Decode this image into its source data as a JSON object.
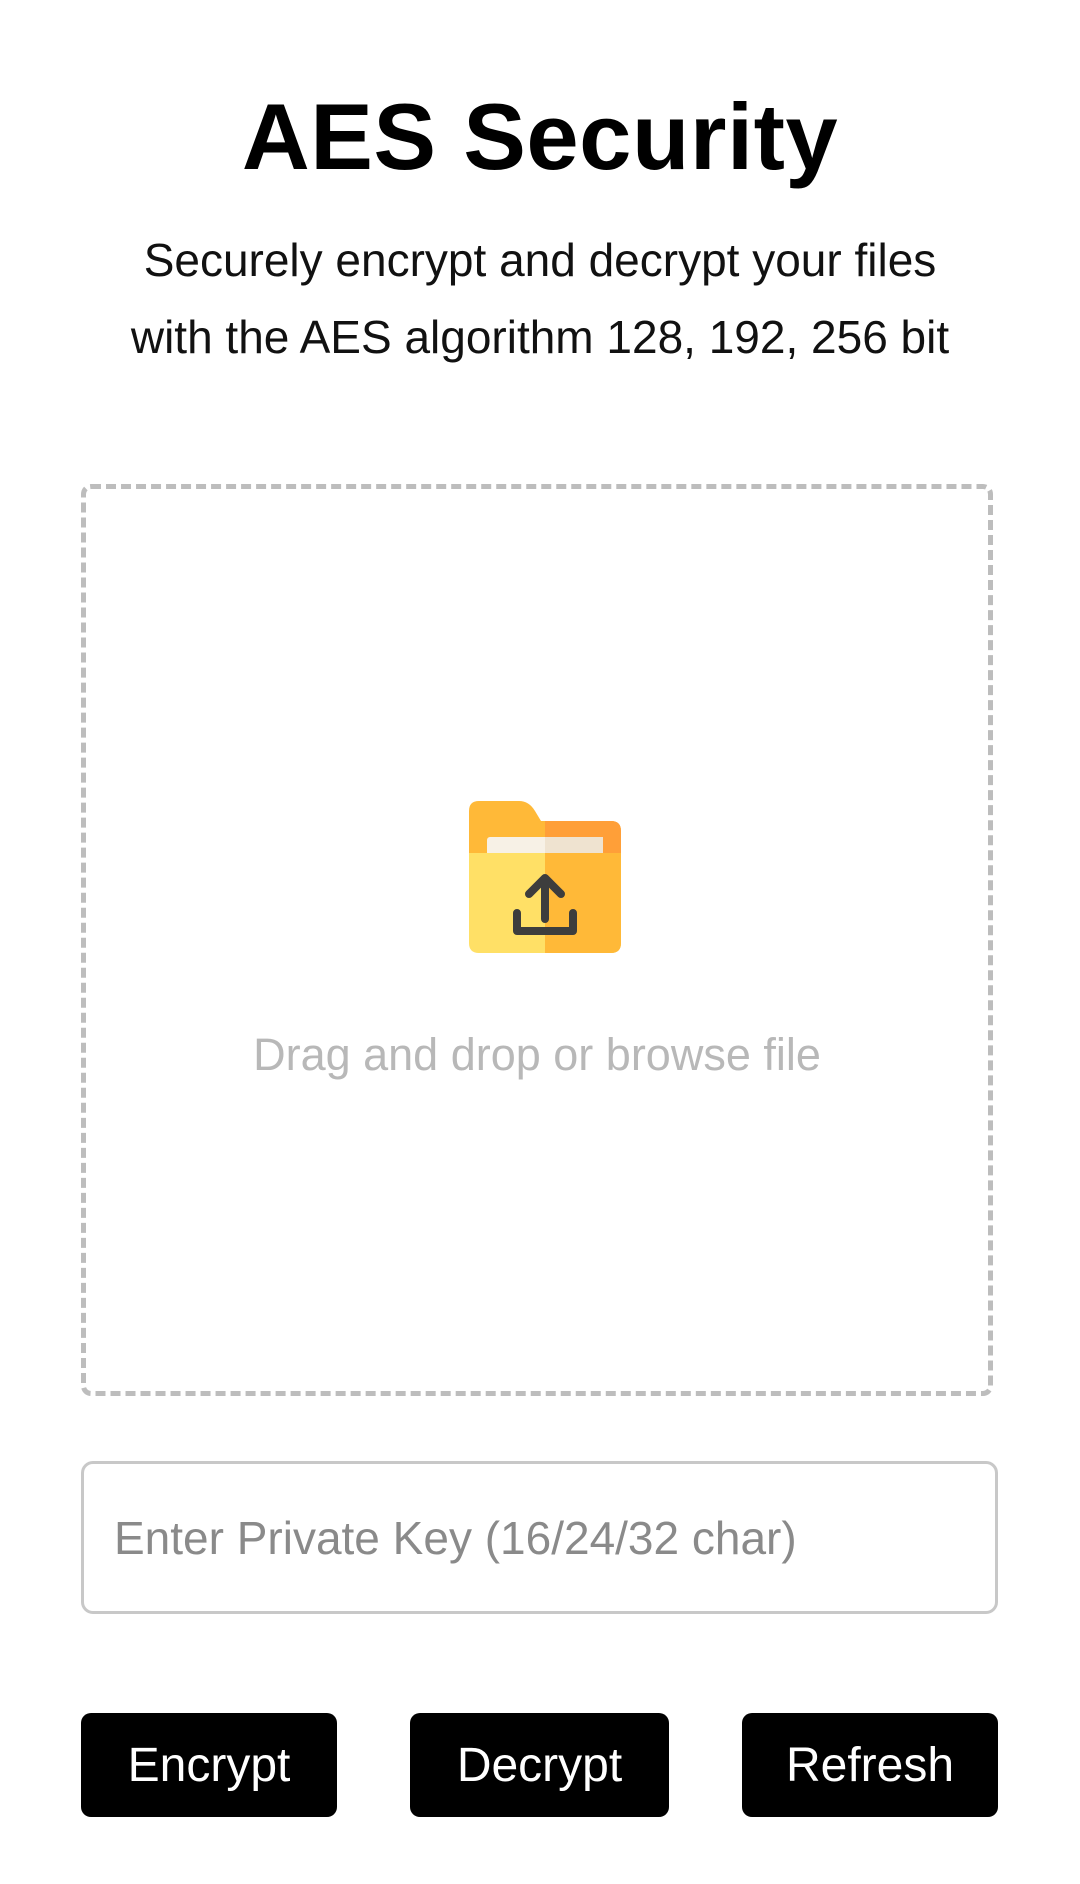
{
  "header": {
    "title": "AES Security",
    "subtitle_line1": "Securely encrypt and decrypt your files",
    "subtitle_line2": "with the AES algorithm 128, 192, 256 bit"
  },
  "dropzone": {
    "icon": "folder-upload-icon",
    "text": "Drag and drop or browse file"
  },
  "key_field": {
    "placeholder": "Enter Private Key (16/24/32 char)",
    "value": ""
  },
  "actions": {
    "encrypt_label": "Encrypt",
    "decrypt_label": "Decrypt",
    "refresh_label": "Refresh"
  },
  "colors": {
    "button_bg": "#000000",
    "button_text": "#ffffff",
    "folder_yellow": "#FFE066",
    "folder_orange": "#FFB938"
  }
}
